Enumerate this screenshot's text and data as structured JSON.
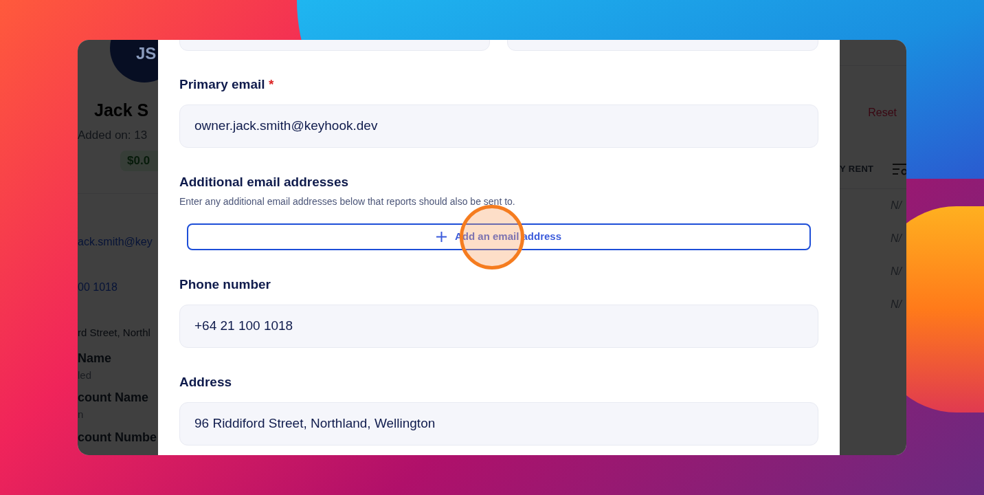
{
  "background_app": {
    "avatar_initials": "JS",
    "name": "Jack S",
    "added_on": "Added on: 13",
    "balance": "$0.0",
    "email": "ack.smith@key",
    "phone": "00 1018",
    "address": "rd Street, Northl",
    "details": [
      {
        "label": "Name",
        "value": "led"
      },
      {
        "label": "count Name",
        "value": "n"
      },
      {
        "label": "count Numbe"
      }
    ],
    "reset": "Reset",
    "column_header": "Y RENT",
    "rows": [
      "N/",
      "N/",
      "N/",
      "N/"
    ]
  },
  "modal": {
    "form": [
      {
        "kind": "input",
        "label": "Primary email",
        "required_mark": "*",
        "value": "owner.jack.smith@keyhook.dev"
      },
      {
        "kind": "list",
        "label": "Additional email addresses",
        "description": "Enter any additional email addresses below that reports should also be sent to.",
        "button": "Add an email address"
      },
      {
        "kind": "input",
        "label": "Phone number",
        "value": "+64 21 100 1018"
      },
      {
        "kind": "input",
        "label": "Address",
        "value": "96 Riddiford Street, Northland, Wellington"
      }
    ]
  }
}
